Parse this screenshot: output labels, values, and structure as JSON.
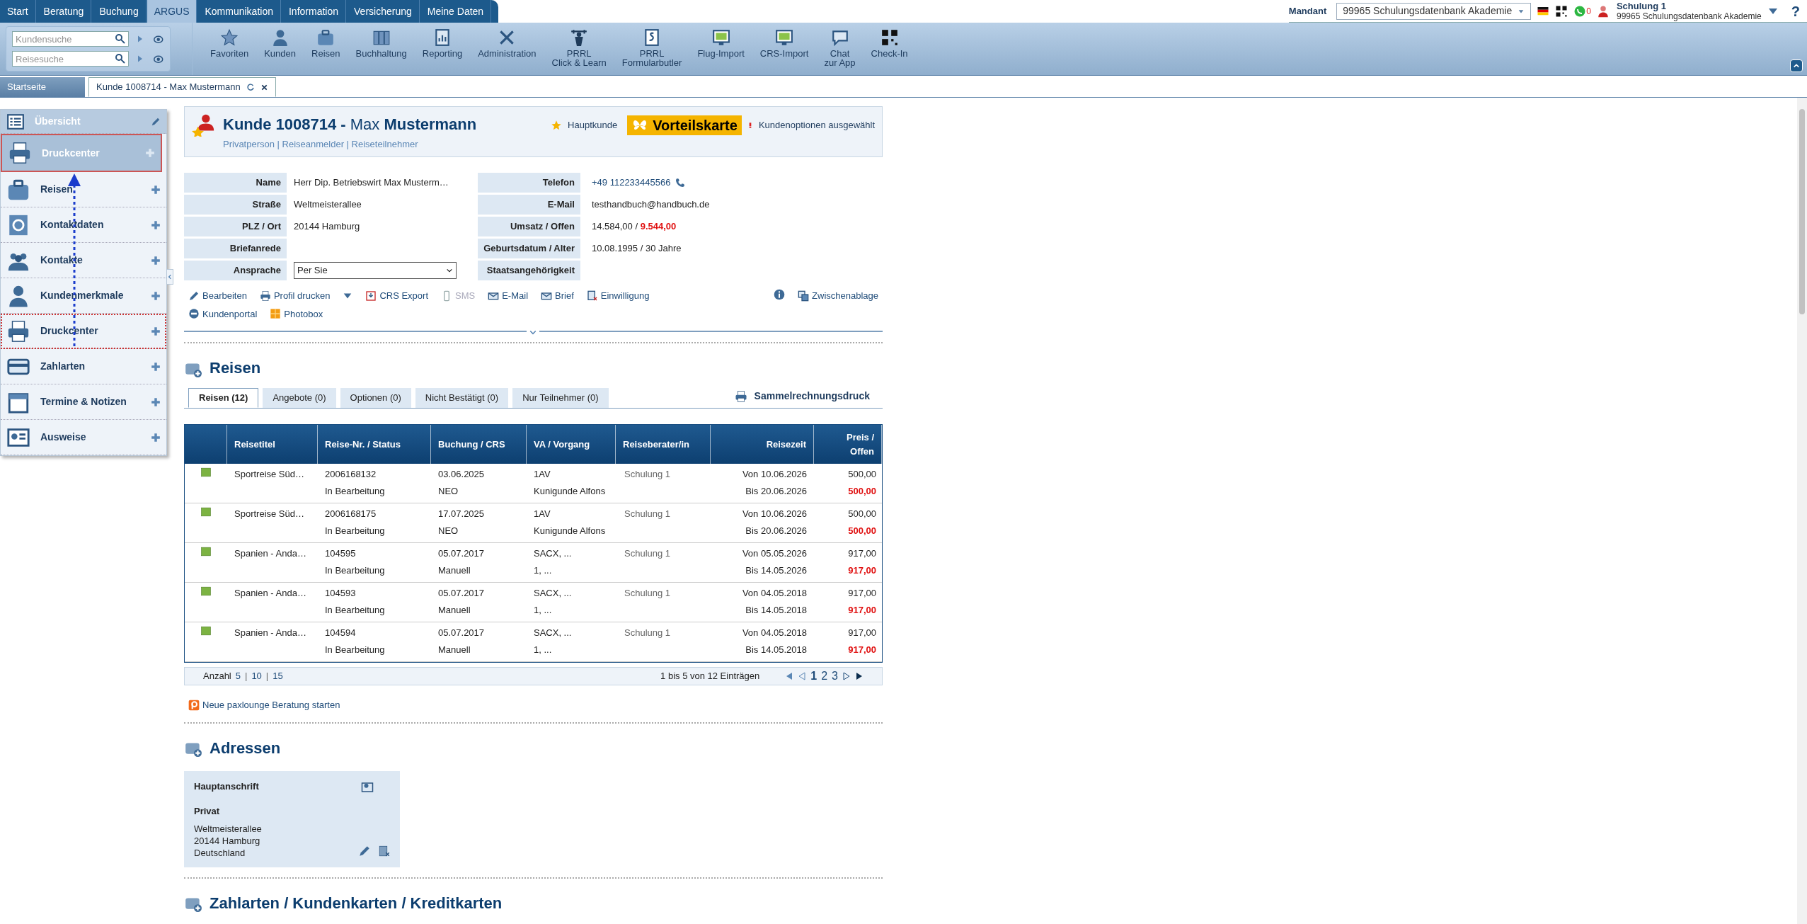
{
  "main_tabs": [
    {
      "label": "Start",
      "selected": false
    },
    {
      "label": "Beratung",
      "selected": false
    },
    {
      "label": "Buchung",
      "selected": false
    },
    {
      "label": "ARGUS",
      "selected": true
    },
    {
      "label": "Kommunikation",
      "selected": false
    },
    {
      "label": "Information",
      "selected": false
    },
    {
      "label": "Versicherung",
      "selected": false
    },
    {
      "label": "Meine Daten",
      "selected": false
    }
  ],
  "quick_search": [
    {
      "placeholder": "Kundensuche"
    },
    {
      "placeholder": "Reisesuche"
    }
  ],
  "toolbar": [
    {
      "kind": "star",
      "lines": [
        "Favoriten"
      ]
    },
    {
      "kind": "person",
      "lines": [
        "Kunden"
      ]
    },
    {
      "kind": "suitcase",
      "lines": [
        "Reisen"
      ]
    },
    {
      "kind": "binders",
      "lines": [
        "Buchhaltung"
      ]
    },
    {
      "kind": "report",
      "lines": [
        "Reporting"
      ]
    },
    {
      "kind": "tools",
      "lines": [
        "Administration"
      ]
    },
    {
      "kind": "learn",
      "lines": [
        "PRRL",
        "Click & Learn"
      ]
    },
    {
      "kind": "paragraph",
      "lines": [
        "PRRL",
        "Formularbutler"
      ]
    },
    {
      "kind": "import",
      "lines": [
        "Flug-Import"
      ]
    },
    {
      "kind": "import",
      "lines": [
        "CRS-Import"
      ]
    },
    {
      "kind": "chat",
      "lines": [
        "Chat",
        "zur App"
      ]
    },
    {
      "kind": "qr",
      "lines": [
        "Check-In"
      ]
    }
  ],
  "header_right": {
    "mandant_label": "Mandant",
    "mandant_value": "99965 Schulungsdatenbank Akademie",
    "chat_count": "0",
    "user_name": "Schulung 1",
    "user_org": "99965 Schulungsdatenbank Akademie",
    "help": "?"
  },
  "open_tabs": [
    {
      "label": "Startseite",
      "selected": false
    },
    {
      "label": "Kunde 1008714 - Max Mustermann",
      "selected": true
    }
  ],
  "sidebar": {
    "items": [
      {
        "kind": "overview",
        "label": "Übersicht",
        "dragging": false
      },
      {
        "kind": "suitcase",
        "label": "Reisen",
        "dragging": false
      },
      {
        "kind": "at",
        "label": "Kontaktdaten",
        "dragging": false
      },
      {
        "kind": "people",
        "label": "Kontakte",
        "dragging": false
      },
      {
        "kind": "person",
        "label": "Kundenmerkmale",
        "dragging": false
      },
      {
        "kind": "printer",
        "label": "Druckcenter",
        "dragging": true
      },
      {
        "kind": "card",
        "label": "Zahlarten",
        "dragging": false
      },
      {
        "kind": "calendar",
        "label": "Termine & Notizen",
        "dragging": false
      },
      {
        "kind": "id",
        "label": "Ausweise",
        "dragging": false
      }
    ],
    "dragged_item": {
      "label": "Druckcenter"
    }
  },
  "customer": {
    "title": "**Kunde 1008714 -** Max **Mustermann**",
    "roles": "Privatperson | Reiseanmelder | Reiseteilnehmer",
    "main_customer": "Hauptkunde",
    "card_badge": "Vorteilskarte",
    "options": "Kundenoptionen ausgewählt",
    "fields_left": [
      {
        "label": "Name",
        "value": "Herr Dip. Betriebswirt Max Musterm…"
      },
      {
        "label": "Straße",
        "value": "Weltmeisterallee"
      },
      {
        "label": "PLZ / Ort",
        "value": "20144 Hamburg"
      },
      {
        "label": "Briefanrede"
      },
      {
        "label": "Ansprache",
        "kind": "select",
        "value": "Per Sie"
      }
    ],
    "fields_right": [
      {
        "label": "Telefon",
        "value": "+49 112233445566",
        "kind": "phone"
      },
      {
        "label": "E-Mail",
        "value": "testhandbuch@handbuch.de"
      },
      {
        "label": "Umsatz / Offen",
        "value": "14.584,00 / ",
        "open": "9.544,00"
      },
      {
        "label": "Geburtsdatum / Alter",
        "value": "10.08.1995 / 30 Jahre"
      },
      {
        "label": "Staatsangehörigkeit"
      }
    ],
    "actions": [
      {
        "kind": "pencil",
        "label": "Bearbeiten",
        "disabled": false
      },
      {
        "kind": "printer",
        "label": "Profil drucken",
        "disabled": false,
        "dropdown": true
      },
      {
        "kind": "crs",
        "label": "CRS Export",
        "disabled": false
      },
      {
        "kind": "phone",
        "label": "SMS",
        "disabled": true
      },
      {
        "kind": "mail",
        "label": "E-Mail",
        "disabled": false
      },
      {
        "kind": "mail",
        "label": "Brief",
        "disabled": false
      },
      {
        "kind": "consent",
        "label": "Einwilligung",
        "disabled": false
      }
    ],
    "actions_second": [
      {
        "kind": "minus",
        "label": "Kundenportal",
        "disabled": false
      },
      {
        "kind": "photo",
        "label": "Photobox",
        "disabled": false
      }
    ],
    "clipboard": "Zwischenablage"
  },
  "reisen": {
    "title": "Reisen",
    "print_all": "Sammelrechnungsdruck",
    "tabs": [
      {
        "label": "Reisen (12)",
        "selected": true
      },
      {
        "label": "Angebote (0)",
        "selected": false
      },
      {
        "label": "Optionen (0)",
        "selected": false
      },
      {
        "label": "Nicht Bestätigt (0)",
        "selected": false
      },
      {
        "label": "Nur Teilnehmer (0)",
        "selected": false
      }
    ],
    "columns": [
      "Reisetitel",
      "Reise-Nr. / Status",
      "Buchung / CRS",
      "VA / Vorgang",
      "Reiseberater/in",
      "Reisezeit",
      "Preis / Offen"
    ],
    "rows": [
      {
        "title": "Sportreise Süd…",
        "number": "2006168132",
        "status": "In Bearbeitung",
        "date": "03.06.2025",
        "crs": "NEO",
        "va": "1AV",
        "vorgang": "Kunigunde Alfons",
        "agent": "Schulung 1",
        "from": "Von 10.06.2026",
        "to": "Bis 20.06.2026",
        "price": "500,00",
        "open": "500,00"
      },
      {
        "title": "Sportreise Süd…",
        "number": "2006168175",
        "status": "In Bearbeitung",
        "date": "17.07.2025",
        "crs": "NEO",
        "va": "1AV",
        "vorgang": "Kunigunde Alfons",
        "agent": "Schulung 1",
        "from": "Von 10.06.2026",
        "to": "Bis 20.06.2026",
        "price": "500,00",
        "open": "500,00"
      },
      {
        "title": "Spanien - Anda…",
        "number": "104595",
        "status": "In Bearbeitung",
        "date": "05.07.2017",
        "crs": "Manuell",
        "va": "SACX, ...",
        "vorgang": "1, ...",
        "agent": "Schulung 1",
        "from": "Von 05.05.2026",
        "to": "Bis 14.05.2026",
        "price": "917,00",
        "open": "917,00"
      },
      {
        "title": "Spanien - Anda…",
        "number": "104593",
        "status": "In Bearbeitung",
        "date": "05.07.2017",
        "crs": "Manuell",
        "va": "SACX, ...",
        "vorgang": "1, ...",
        "agent": "Schulung 1",
        "from": "Von 04.05.2018",
        "to": "Bis 14.05.2018",
        "price": "917,00",
        "open": "917,00"
      },
      {
        "title": "Spanien - Anda…",
        "number": "104594",
        "status": "In Bearbeitung",
        "date": "05.07.2017",
        "crs": "Manuell",
        "va": "SACX, ...",
        "vorgang": "1, ...",
        "agent": "Schulung 1",
        "from": "Von 04.05.2018",
        "to": "Bis 14.05.2018",
        "price": "917,00",
        "open": "917,00"
      }
    ],
    "pager": {
      "count_label": "Anzahl",
      "sizes": [
        "5",
        "10",
        "15"
      ],
      "separator": "|",
      "summary": "1 bis 5 von 12 Einträgen",
      "pages": [
        {
          "label": "1",
          "selected": true
        },
        {
          "label": "2",
          "selected": false
        },
        {
          "label": "3",
          "selected": false
        }
      ]
    },
    "paxlounge": "Neue paxlounge Beratung starten"
  },
  "adressen": {
    "title": "Adressen",
    "card": {
      "heading": "Hauptanschrift",
      "type": "Privat",
      "lines": [
        "Weltmeisterallee",
        "20144 Hamburg",
        "Deutschland"
      ]
    }
  },
  "zahlarten": {
    "title": "Zahlarten / Kundenkarten / Kreditkarten"
  }
}
